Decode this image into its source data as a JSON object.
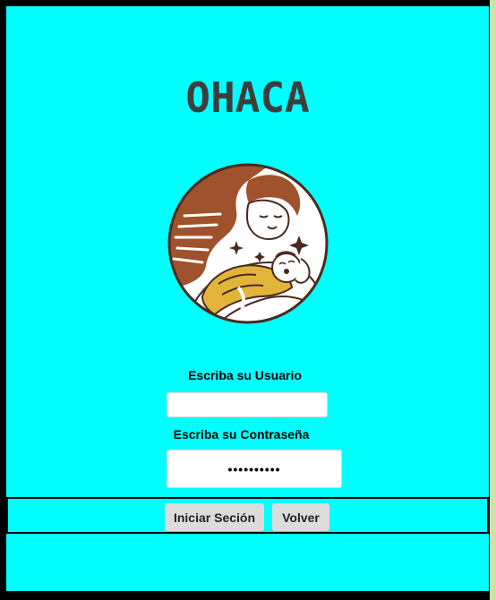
{
  "app": {
    "title": "OHACA",
    "logo": {
      "icon": "mother-baby-logo",
      "colors": {
        "hair": "#a0522d",
        "outline": "#4a2a1f",
        "blanket": "#e2b53a",
        "background": "#ffffff"
      }
    }
  },
  "login": {
    "username_label": "Escriba su Usuario",
    "username_value": "",
    "password_label": "Escriba su Contraseña",
    "password_value": "••••••••••",
    "submit_label": "Iniciar Seción",
    "back_label": "Volver"
  },
  "colors": {
    "page_background": "#00ffff",
    "title_color": "#3d3d3d",
    "button_background": "#dcdcdc"
  }
}
